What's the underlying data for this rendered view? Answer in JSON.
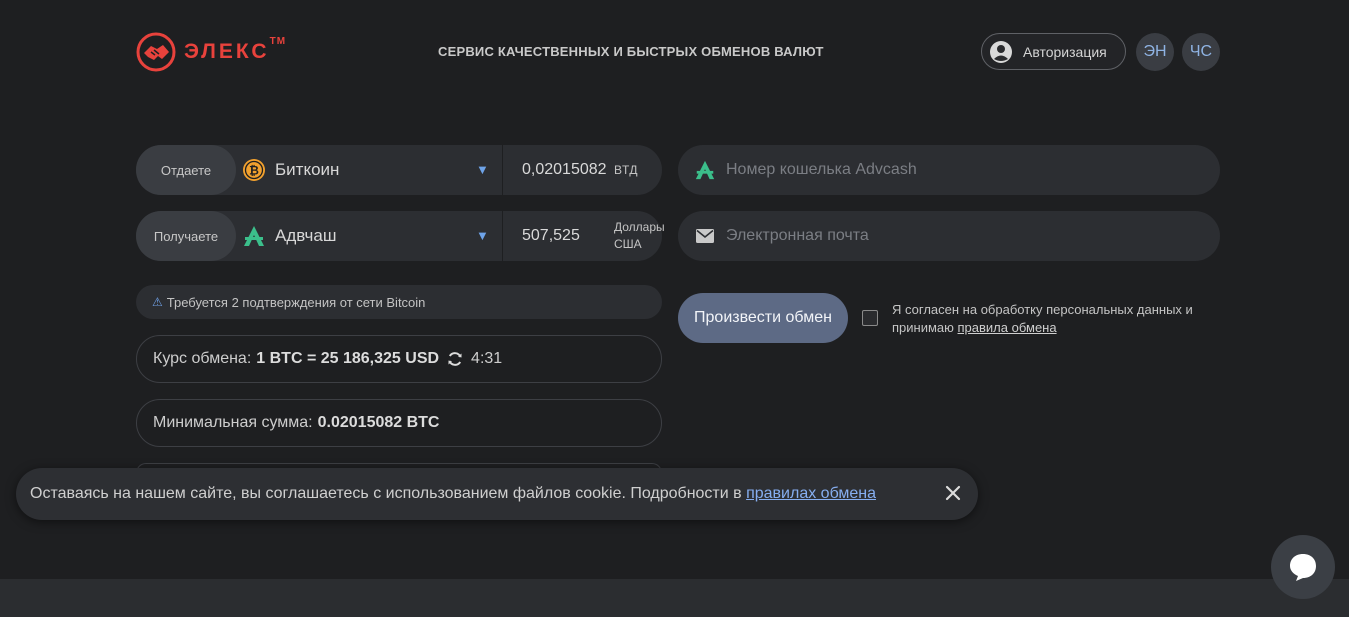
{
  "header": {
    "logo_text": "ЭЛЕКС",
    "logo_tm": "TM",
    "tagline": "СЕРВИС КАЧЕСТВЕННЫХ И БЫСТРЫХ ОБМЕНОВ ВАЛЮТ",
    "auth_label": "Авторизация",
    "lang_en": "ЭН",
    "lang_ch": "ЧС"
  },
  "give": {
    "label": "Отдаете",
    "currency": "Биткоин",
    "currency_icon": "bitcoin-icon",
    "amount": "0,02015082",
    "unit": "BTД"
  },
  "receive": {
    "label": "Получаете",
    "currency": "Адвчаш",
    "currency_icon": "advcash-icon",
    "amount": "507,525",
    "unit_line1": "Доллары",
    "unit_line2": "США"
  },
  "fields": {
    "wallet_placeholder": "Номер кошелька Advcash",
    "email_placeholder": "Электронная почта"
  },
  "notice": {
    "text": "Требуется 2 подтверждения от сети Bitcoin"
  },
  "rate": {
    "label": "Курс обмена:",
    "value": "1 BTC = 25 186,325 USD",
    "timer": "4:31"
  },
  "minimum": {
    "label": "Минимальная сумма:",
    "value": "0.02015082 BTC"
  },
  "action": {
    "button": "Произвести обмен",
    "consent_text": "Я согласен на обработку персональных данных и принимаю",
    "consent_link": "правила обмена"
  },
  "cookie": {
    "text": "Оставаясь на нашем сайте, вы соглашаетесь с использованием файлов cookie. Подробности в",
    "link": "правилах обмена"
  },
  "colors": {
    "brand": "#e8423c",
    "accent": "#5d6a85",
    "background": "#1e1f21"
  }
}
